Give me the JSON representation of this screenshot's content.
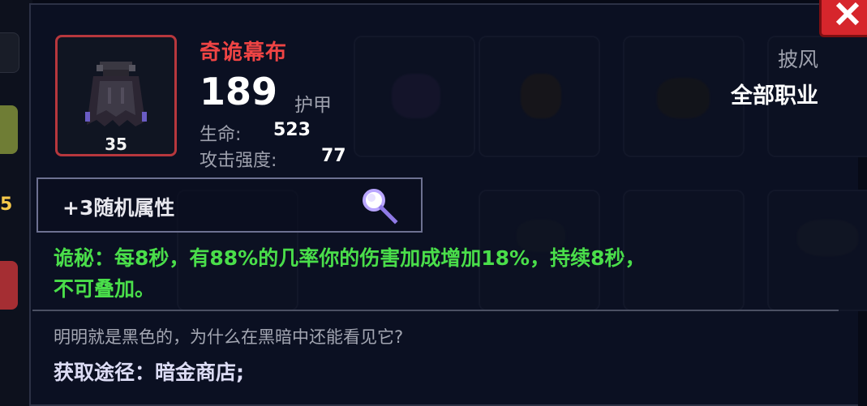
{
  "item": {
    "name": "奇诡幕布",
    "level": "35",
    "armor_value": "189",
    "armor_label": "护甲",
    "stats": [
      {
        "label": "生命:",
        "value": "523"
      },
      {
        "label": "攻击强度:",
        "value": "77"
      }
    ],
    "slot_type": "披风",
    "class_requirement": "全部职业",
    "random_attributes": "+3随机属性",
    "effect_line1": "诡秘：每8秒，有88%的几率你的伤害加成增加18%，持续8秒，",
    "effect_line2": "不可叠加。",
    "flavor_text": "明明就是黑色的，为什么在黑暗中还能看见它?",
    "source": "获取途径：暗金商店;"
  },
  "side_badge": "5",
  "icons": {
    "item": "dark-cloak-icon",
    "inspect": "magnifier-icon",
    "close": "close-x-icon"
  },
  "colors": {
    "name": "#ef4444",
    "effect": "#4ade4a",
    "frame_border": "#b7373d",
    "close_button": "#d6262c"
  }
}
